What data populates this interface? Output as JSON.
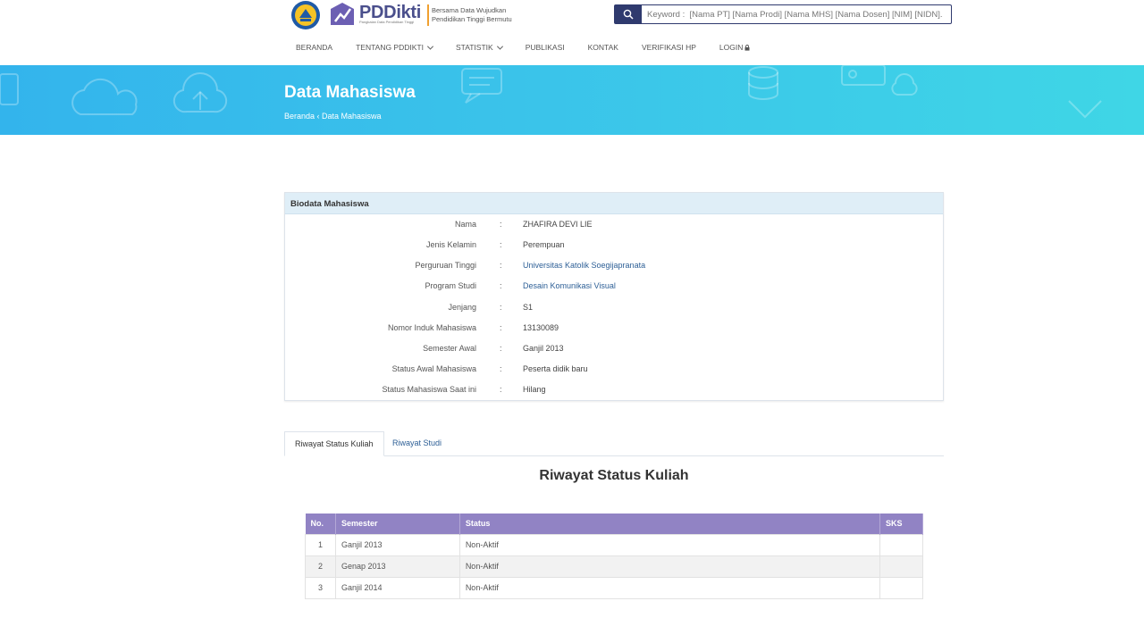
{
  "header": {
    "brand": "PDDikti",
    "brand_sub": "Pangkalan Data Pendidikan Tinggi",
    "tagline": "Bersama Data Wujudkan Pendidikan Tinggi Bermutu",
    "search_placeholder": "Keyword :  [Nama PT] [Nama Prodi] [Nama MHS] [Nama Dosen] [NIM] [NIDN]."
  },
  "nav": {
    "items": [
      {
        "label": "BERANDA"
      },
      {
        "label": "TENTANG PDDIKTI"
      },
      {
        "label": "STATISTIK"
      },
      {
        "label": "PUBLIKASI"
      },
      {
        "label": "KONTAK"
      },
      {
        "label": "VERIFIKASI HP"
      },
      {
        "label": "LOGIN"
      }
    ]
  },
  "banner": {
    "title": "Data Mahasiswa",
    "breadcrumb": "Beranda ‹ Data Mahasiswa"
  },
  "biodata": {
    "heading": "Biodata Mahasiswa",
    "rows": [
      {
        "label": "Nama",
        "value": "ZHAFIRA DEVI LIE"
      },
      {
        "label": "Jenis Kelamin",
        "value": "Perempuan"
      },
      {
        "label": "Perguruan Tinggi",
        "value": "Universitas Katolik Soegijapranata"
      },
      {
        "label": "Program Studi",
        "value": "Desain Komunikasi Visual"
      },
      {
        "label": "Jenjang",
        "value": "S1"
      },
      {
        "label": "Nomor Induk Mahasiswa",
        "value": "13130089"
      },
      {
        "label": "Semester Awal",
        "value": "Ganjil 2013"
      },
      {
        "label": "Status Awal Mahasiswa",
        "value": "Peserta didik baru"
      },
      {
        "label": "Status Mahasiswa Saat ini",
        "value": "Hilang"
      }
    ]
  },
  "tabs": {
    "active": "Riwayat Status Kuliah",
    "inactive": "Riwayat Studi"
  },
  "section_title": "Riwayat Status Kuliah",
  "table": {
    "headers": [
      "No.",
      "Semester",
      "Status",
      "SKS"
    ],
    "rows": [
      {
        "no": "1",
        "semester": "Ganjil 2013",
        "status": "Non-Aktif",
        "sks": ""
      },
      {
        "no": "2",
        "semester": "Genap 2013",
        "status": "Non-Aktif",
        "sks": ""
      },
      {
        "no": "3",
        "semester": "Ganjil 2014",
        "status": "Non-Aktif",
        "sks": ""
      }
    ]
  },
  "colors": {
    "navy": "#2f3a6e",
    "banner_from": "#33b4ec",
    "banner_to": "#3fd6e6",
    "table_header": "#9183c4",
    "link": "#2d5f96"
  }
}
